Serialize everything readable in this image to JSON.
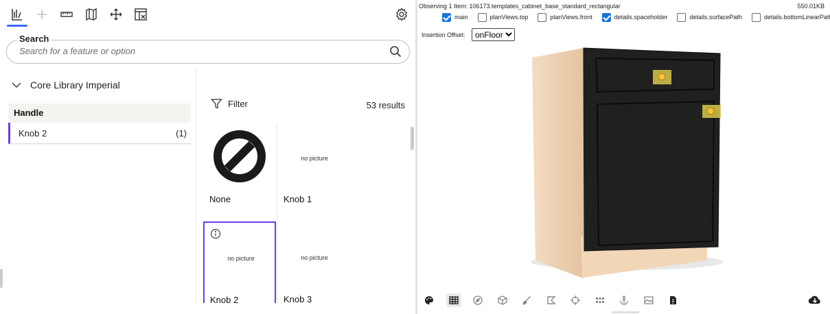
{
  "toolbar": {
    "icons": [
      "catalog-icon",
      "plus-icon",
      "ruler-icon",
      "map-icon",
      "move-icon",
      "layout-icon"
    ],
    "settings_icon": "gear-icon"
  },
  "search": {
    "legend": "Search",
    "placeholder": "Search for a feature or option"
  },
  "library": {
    "label": "Core Library Imperial"
  },
  "category": {
    "heading": "Handle",
    "selected_item": {
      "label": "Knob 2",
      "count": "(1)"
    }
  },
  "results": {
    "filter_label": "Filter",
    "count_text": "53 results",
    "cards": [
      {
        "name": "None",
        "picture": "prohibited-icon"
      },
      {
        "name": "Knob 1",
        "picture_text": "no picture"
      },
      {
        "name": "Knob 2",
        "picture_text": "no picture",
        "selected": true
      },
      {
        "name": "Knob 3",
        "picture_text": "no picture"
      }
    ]
  },
  "viewer": {
    "observing": "Observing 1 Item: 106173.templates_cabinet_base_standard_rectangular",
    "size": "550.01KB",
    "checkboxes": [
      {
        "label": "main",
        "checked": true
      },
      {
        "label": "planViews.top",
        "checked": false
      },
      {
        "label": "planViews.front",
        "checked": false
      },
      {
        "label": "details.spaceholder",
        "checked": true
      },
      {
        "label": "details.surfacePath",
        "checked": false
      },
      {
        "label": "details.bottomLinearPath",
        "checked": false
      }
    ],
    "insertion_offset_label": "Insertion Offset:",
    "insertion_offset_value": "onFloor",
    "bottom_tools": [
      "palette-icon",
      "grid-icon",
      "compass-icon",
      "cube-icon",
      "brush-icon",
      "shape-icon",
      "target-icon",
      "dots-grid-icon",
      "anchor-icon",
      "image-icon",
      "document-icon"
    ],
    "download_icon": "cloud-download-icon"
  },
  "colors": {
    "accent": "#6a3ee0",
    "tab_indicator": "#3b6cff",
    "checkbox": "#1976d2",
    "cabinet_side": "#f0d2b3",
    "cabinet_door": "#1a1a1a",
    "knob": "#e7b62a"
  }
}
